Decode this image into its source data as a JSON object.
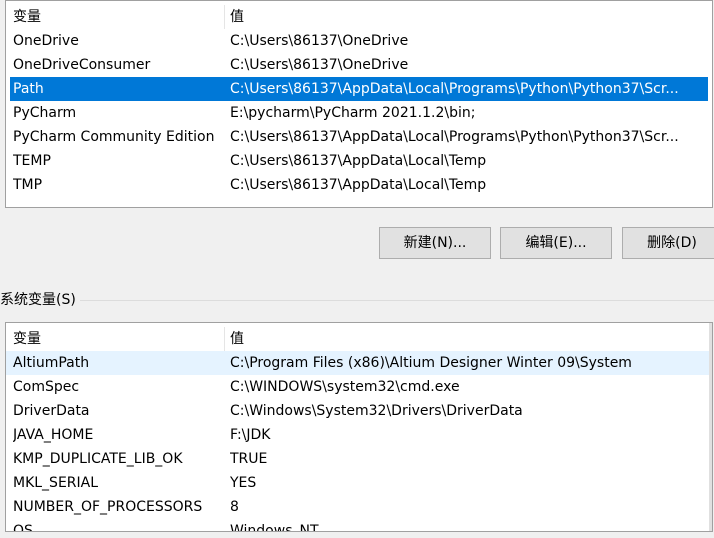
{
  "user_vars": {
    "header": {
      "name": "变量",
      "value": "值"
    },
    "rows": [
      {
        "name": "OneDrive",
        "value": "C:\\Users\\86137\\OneDrive"
      },
      {
        "name": "OneDriveConsumer",
        "value": "C:\\Users\\86137\\OneDrive"
      },
      {
        "name": "Path",
        "value": "C:\\Users\\86137\\AppData\\Local\\Programs\\Python\\Python37\\Scr..."
      },
      {
        "name": "PyCharm",
        "value": "E:\\pycharm\\PyCharm 2021.1.2\\bin;"
      },
      {
        "name": "PyCharm Community Edition",
        "value": "C:\\Users\\86137\\AppData\\Local\\Programs\\Python\\Python37\\Scr..."
      },
      {
        "name": "TEMP",
        "value": "C:\\Users\\86137\\AppData\\Local\\Temp"
      },
      {
        "name": "TMP",
        "value": "C:\\Users\\86137\\AppData\\Local\\Temp"
      }
    ],
    "selected": "Path"
  },
  "buttons": {
    "new": "新建(N)...",
    "edit": "编辑(E)...",
    "delete": "删除(D)"
  },
  "system_group_label": "系统变量(S)",
  "system_vars": {
    "header": {
      "name": "变量",
      "value": "值"
    },
    "rows": [
      {
        "name": "AltiumPath",
        "value": "C:\\Program Files (x86)\\Altium Designer Winter 09\\System"
      },
      {
        "name": "ComSpec",
        "value": "C:\\WINDOWS\\system32\\cmd.exe"
      },
      {
        "name": "DriverData",
        "value": "C:\\Windows\\System32\\Drivers\\DriverData"
      },
      {
        "name": "JAVA_HOME",
        "value": "F:\\JDK"
      },
      {
        "name": "KMP_DUPLICATE_LIB_OK",
        "value": "TRUE"
      },
      {
        "name": "MKL_SERIAL",
        "value": "YES"
      },
      {
        "name": "NUMBER_OF_PROCESSORS",
        "value": "8"
      },
      {
        "name": "OS",
        "value": "Windows_NT"
      }
    ]
  },
  "colors": {
    "selection": "#0078d7",
    "hover": "#e5f3ff"
  }
}
